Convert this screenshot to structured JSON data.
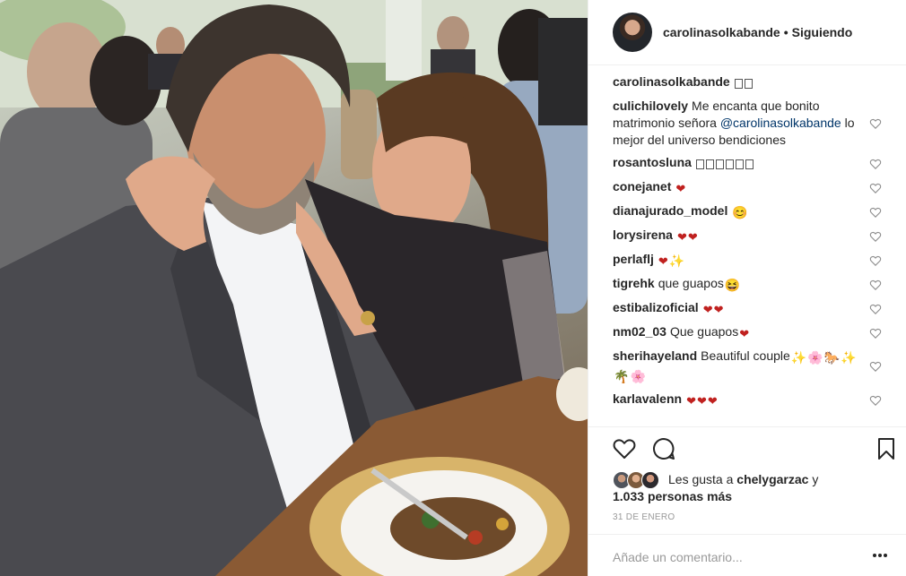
{
  "post": {
    "image_alt": "",
    "author": "carolinasolkabande",
    "separator": "•",
    "follow_status": "Siguiendo"
  },
  "comments": [
    {
      "user": "carolinasolkabande",
      "text": "",
      "emoji": [
        "blank-box",
        "blank-box"
      ],
      "heart": false
    },
    {
      "user": "culichilovely",
      "text": "Me encanta que bonito matrimonio señora",
      "mention": "@carolinasolkabande",
      "text_after": "lo mejor del universo bendiciones",
      "heart": true
    },
    {
      "user": "rosantosluna",
      "text": "",
      "emoji": [
        "blank-box",
        "blank-box",
        "blank-box",
        "blank-box",
        "blank-box",
        "blank-box"
      ],
      "heart": true
    },
    {
      "user": "conejanet",
      "text": "",
      "emoji": [
        "red-heart"
      ],
      "heart": true
    },
    {
      "user": "dianajurado_model",
      "text": "",
      "emoji": [
        "smiling-face"
      ],
      "heart": true
    },
    {
      "user": "lorysirena",
      "text": "",
      "emoji": [
        "red-heart",
        "red-heart"
      ],
      "heart": true
    },
    {
      "user": "perlaflj",
      "text": "",
      "emoji": [
        "red-heart",
        "sparkles"
      ],
      "heart": true
    },
    {
      "user": "tigrehk",
      "text": "que guapos",
      "emoji": [
        "grinning-face"
      ],
      "heart": true
    },
    {
      "user": "estibalizoficial",
      "text": "",
      "emoji": [
        "red-heart",
        "red-heart"
      ],
      "heart": true
    },
    {
      "user": "nm02_03",
      "text": "Que guapos",
      "emoji": [
        "red-heart"
      ],
      "heart": true
    },
    {
      "user": "sherihayeland",
      "text": "Beautiful couple",
      "emoji": [
        "sparkles",
        "cherry-blossom",
        "horse",
        "sparkles",
        "palm-tree",
        "cherry-blossom"
      ],
      "heart": true
    },
    {
      "user": "karlavalenn",
      "text": "",
      "emoji": [
        "heart-kiss",
        "heart-kiss",
        "heart-kiss"
      ],
      "heart": true
    }
  ],
  "likes": {
    "prefix": "Les gusta a",
    "first_user": "chelygarzac",
    "conj": "y",
    "count": "1.033",
    "suffix": "personas más"
  },
  "date": "31 DE ENERO",
  "add_comment": {
    "placeholder": "Añade un comentario..."
  },
  "icons": {
    "like": "heart-outline-icon",
    "comment": "comment-bubble-icon",
    "save": "bookmark-icon",
    "more": "more-options-icon"
  }
}
